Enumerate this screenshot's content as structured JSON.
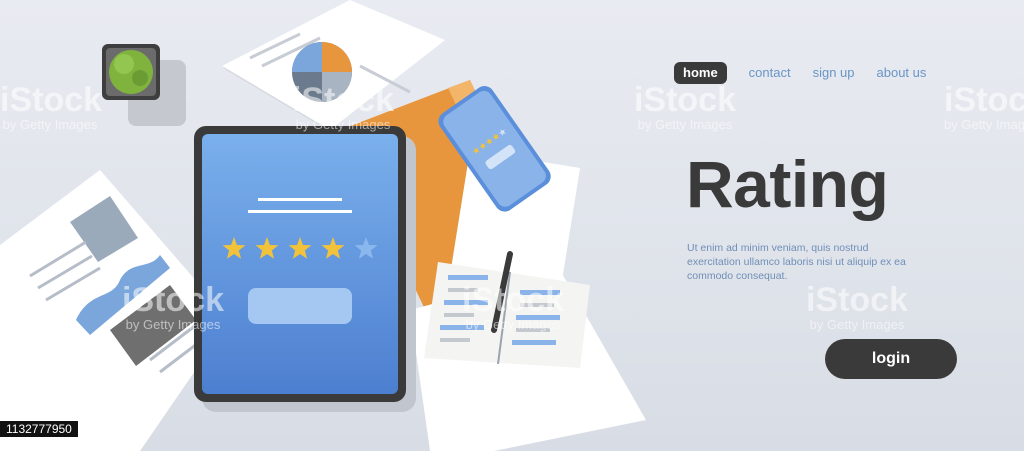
{
  "nav": {
    "items": [
      {
        "label": "home",
        "active": true
      },
      {
        "label": "contact",
        "active": false
      },
      {
        "label": "sign up",
        "active": false
      },
      {
        "label": "about us",
        "active": false
      }
    ]
  },
  "hero": {
    "title": "Rating",
    "body": "Ut enim ad minim veniam, quis nostrud exercitation ullamco laboris nisi ut aliquip ex ea commodo consequat.",
    "login_label": "login"
  },
  "tablet": {
    "rating": 4,
    "max_rating": 5,
    "star_color": "#f2c33a"
  },
  "phone": {
    "rating": 4,
    "max_rating": 5
  },
  "watermark": {
    "brand": "iStock",
    "credit": "by Getty Images"
  },
  "stock_id": "1132777950",
  "colors": {
    "accent_dark": "#3a3a3a",
    "link_blue": "#6a95c6",
    "folder_orange": "#e8963e",
    "screen_blue": "#5b8fdb"
  }
}
